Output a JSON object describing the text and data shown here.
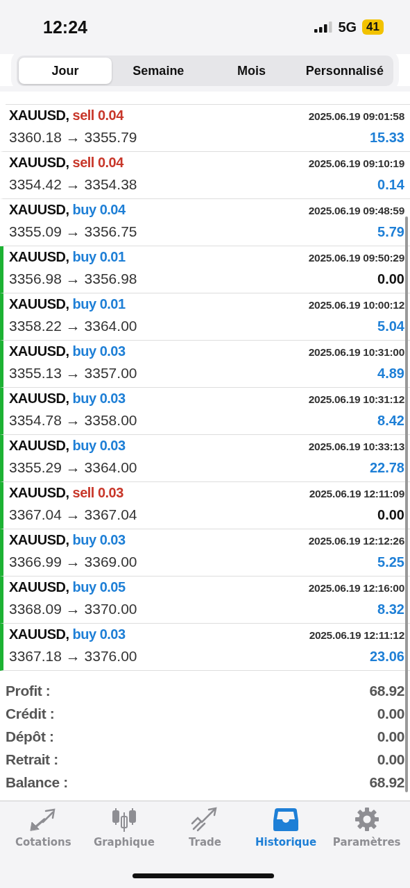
{
  "status_bar": {
    "time": "12:24",
    "network": "5G",
    "battery": "41"
  },
  "tabs": [
    {
      "label": "Jour",
      "selected": true
    },
    {
      "label": "Semaine",
      "selected": false
    },
    {
      "label": "Mois",
      "selected": false
    },
    {
      "label": "Personnalisé",
      "selected": false
    }
  ],
  "trades": [
    {
      "symbol": "XAUUSD,",
      "order": {
        "kind": "sell",
        "text": "sell 0.04"
      },
      "time": "2025.06.19 09:01:58",
      "prices": "3360.18 → 3355.79",
      "profit": {
        "kind": "gain",
        "text": "15.33"
      },
      "marked": false
    },
    {
      "symbol": "XAUUSD,",
      "order": {
        "kind": "sell",
        "text": "sell 0.04"
      },
      "time": "2025.06.19 09:10:19",
      "prices": "3354.42 → 3354.38",
      "profit": {
        "kind": "gain",
        "text": "0.14"
      },
      "marked": false
    },
    {
      "symbol": "XAUUSD,",
      "order": {
        "kind": "buy",
        "text": "buy 0.04"
      },
      "time": "2025.06.19 09:48:59",
      "prices": "3355.09 → 3356.75",
      "profit": {
        "kind": "gain",
        "text": "5.79"
      },
      "marked": false
    },
    {
      "symbol": "XAUUSD,",
      "order": {
        "kind": "buy",
        "text": "buy 0.01"
      },
      "time": "2025.06.19 09:50:29",
      "prices": "3356.98 → 3356.98",
      "profit": {
        "kind": "zero",
        "text": "0.00"
      },
      "marked": true
    },
    {
      "symbol": "XAUUSD,",
      "order": {
        "kind": "buy",
        "text": "buy 0.01"
      },
      "time": "2025.06.19 10:00:12",
      "prices": "3358.22 → 3364.00",
      "profit": {
        "kind": "gain",
        "text": "5.04"
      },
      "marked": true
    },
    {
      "symbol": "XAUUSD,",
      "order": {
        "kind": "buy",
        "text": "buy 0.03"
      },
      "time": "2025.06.19 10:31:00",
      "prices": "3355.13 → 3357.00",
      "profit": {
        "kind": "gain",
        "text": "4.89"
      },
      "marked": true
    },
    {
      "symbol": "XAUUSD,",
      "order": {
        "kind": "buy",
        "text": "buy 0.03"
      },
      "time": "2025.06.19 10:31:12",
      "prices": "3354.78 → 3358.00",
      "profit": {
        "kind": "gain",
        "text": "8.42"
      },
      "marked": true
    },
    {
      "symbol": "XAUUSD,",
      "order": {
        "kind": "buy",
        "text": "buy 0.03"
      },
      "time": "2025.06.19 10:33:13",
      "prices": "3355.29 → 3364.00",
      "profit": {
        "kind": "gain",
        "text": "22.78"
      },
      "marked": true
    },
    {
      "symbol": "XAUUSD,",
      "order": {
        "kind": "sell",
        "text": "sell 0.03"
      },
      "time": "2025.06.19 12:11:09",
      "prices": "3367.04 → 3367.04",
      "profit": {
        "kind": "zero",
        "text": "0.00"
      },
      "marked": true
    },
    {
      "symbol": "XAUUSD,",
      "order": {
        "kind": "buy",
        "text": "buy 0.03"
      },
      "time": "2025.06.19 12:12:26",
      "prices": "3366.99 → 3369.00",
      "profit": {
        "kind": "gain",
        "text": "5.25"
      },
      "marked": true
    },
    {
      "symbol": "XAUUSD,",
      "order": {
        "kind": "buy",
        "text": "buy 0.05"
      },
      "time": "2025.06.19 12:16:00",
      "prices": "3368.09 → 3370.00",
      "profit": {
        "kind": "gain",
        "text": "8.32"
      },
      "marked": true
    },
    {
      "symbol": "XAUUSD,",
      "order": {
        "kind": "buy",
        "text": "buy 0.03"
      },
      "time": "2025.06.19 12:11:12",
      "prices": "3367.18 → 3376.00",
      "profit": {
        "kind": "gain",
        "text": "23.06"
      },
      "marked": true
    }
  ],
  "summary": [
    {
      "label": "Profit :",
      "value": "68.92"
    },
    {
      "label": "Crédit :",
      "value": "0.00"
    },
    {
      "label": "Dépôt :",
      "value": "0.00"
    },
    {
      "label": "Retrait :",
      "value": "0.00"
    },
    {
      "label": "Balance :",
      "value": "68.92"
    }
  ],
  "nav": [
    {
      "label": "Cotations",
      "kind": "arrows",
      "selected": false
    },
    {
      "label": "Graphique",
      "kind": "candles",
      "selected": false
    },
    {
      "label": "Trade",
      "kind": "trend",
      "selected": false
    },
    {
      "label": "Historique",
      "kind": "inbox",
      "selected": true
    },
    {
      "label": "Paramètres",
      "kind": "gear",
      "selected": false
    }
  ]
}
